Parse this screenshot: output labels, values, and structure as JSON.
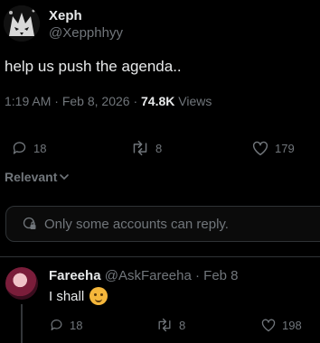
{
  "post": {
    "author_name": "Xeph",
    "author_handle": "@Xepphhyy",
    "text": "help us push the agenda..",
    "time": "1:19 AM",
    "sep1": "·",
    "date": "Feb 8, 2026",
    "sep2": "·",
    "views_count": "74.8K",
    "views_label": "Views",
    "replies": "18",
    "reposts": "8",
    "likes": "179"
  },
  "sort": {
    "label": "Relevant"
  },
  "reply_notice": {
    "text": "Only some accounts can reply."
  },
  "reply": {
    "author_name": "Fareeha",
    "author_handle": "@AskFareeha",
    "sep": "·",
    "date": "Feb 8",
    "text": "I shall",
    "replies": "18",
    "reposts": "8",
    "likes": "198"
  },
  "colors": {
    "background": "#000000",
    "text": "#e7e9ea",
    "muted": "#71767b",
    "border": "#2f3336"
  },
  "icons": [
    "wolf-avatar",
    "reply-icon",
    "repost-icon",
    "like-icon",
    "chevron-down-icon",
    "globe-lock-icon",
    "smile-emoji"
  ]
}
